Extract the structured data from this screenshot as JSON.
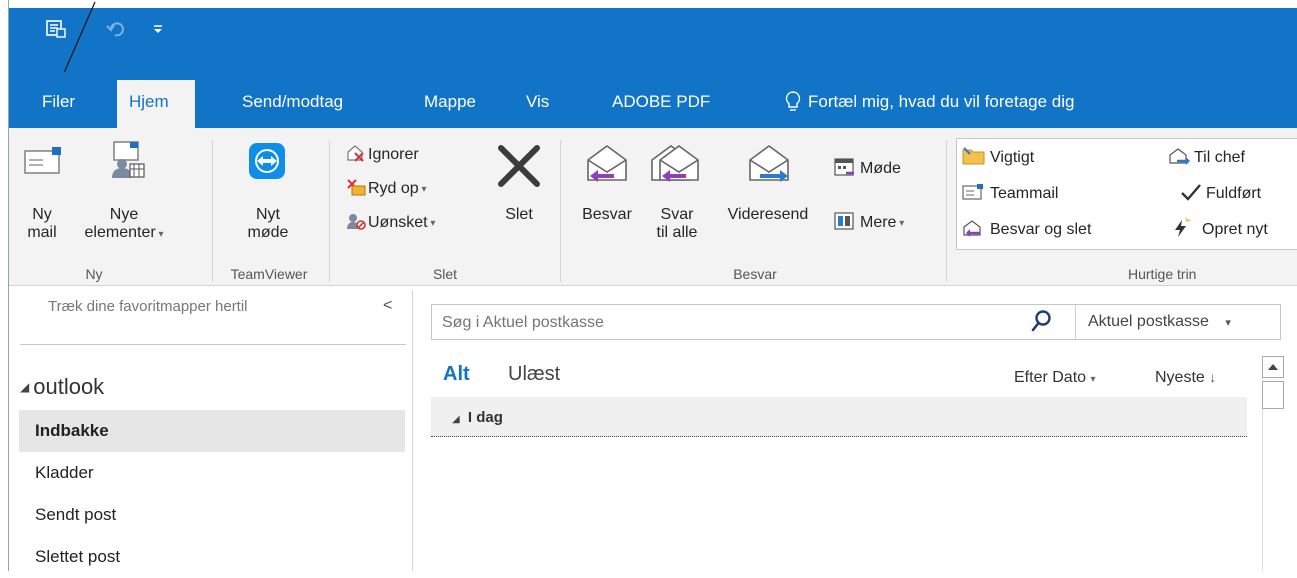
{
  "quick_access": {
    "icons": [
      "send-receive-icon",
      "undo-icon",
      "customize-qat-icon"
    ]
  },
  "tabs": [
    {
      "label": "Filer",
      "active": false
    },
    {
      "label": "Hjem",
      "active": true
    },
    {
      "label": "Send/modtag",
      "active": false
    },
    {
      "label": "Mappe",
      "active": false
    },
    {
      "label": "Vis",
      "active": false
    },
    {
      "label": "ADOBE PDF",
      "active": false
    },
    {
      "label": "Fortæl mig, hvad du vil foretage dig",
      "active": false
    }
  ],
  "ribbon": {
    "ny": {
      "group": "Ny",
      "new_mail": [
        "Ny",
        "mail"
      ],
      "new_items": [
        "Nye",
        "elementer"
      ]
    },
    "teamviewer": {
      "group": "TeamViewer",
      "meeting": [
        "Nyt",
        "møde"
      ]
    },
    "slet": {
      "group": "Slet",
      "ignore": "Ignorer",
      "cleanup": "Ryd op",
      "junk": "Uønsket",
      "delete": "Slet"
    },
    "besvar": {
      "group": "Besvar",
      "reply": "Besvar",
      "reply_all": [
        "Svar",
        "til alle"
      ],
      "forward": "Videresend",
      "meeting": "Møde",
      "more": "Mere"
    },
    "quick_steps": {
      "group": "Hurtige trin",
      "items": [
        "Vigtigt",
        "Til chef",
        "Teammail",
        "Fuldført",
        "Besvar og slet",
        "Opret nyt"
      ]
    }
  },
  "left_panel": {
    "favorites_hint": "Træk dine favoritmapper hertil",
    "collapse_glyph": "<",
    "account": "outlook",
    "folders": [
      "Indbakke",
      "Kladder",
      "Sendt post",
      "Slettet post"
    ],
    "selected_folder": "Indbakke"
  },
  "search": {
    "placeholder": "Søg i Aktuel postkasse",
    "scope": "Aktuel postkasse"
  },
  "list": {
    "filter_all": "Alt",
    "filter_unread": "Ulæst",
    "sort_by": "Efter Dato",
    "order": "Nyeste",
    "group_header": "I dag"
  },
  "colors": {
    "accent": "#1274c6",
    "ribbon_bg": "#f3f3f3",
    "selected_bg": "#e6e6e6"
  }
}
